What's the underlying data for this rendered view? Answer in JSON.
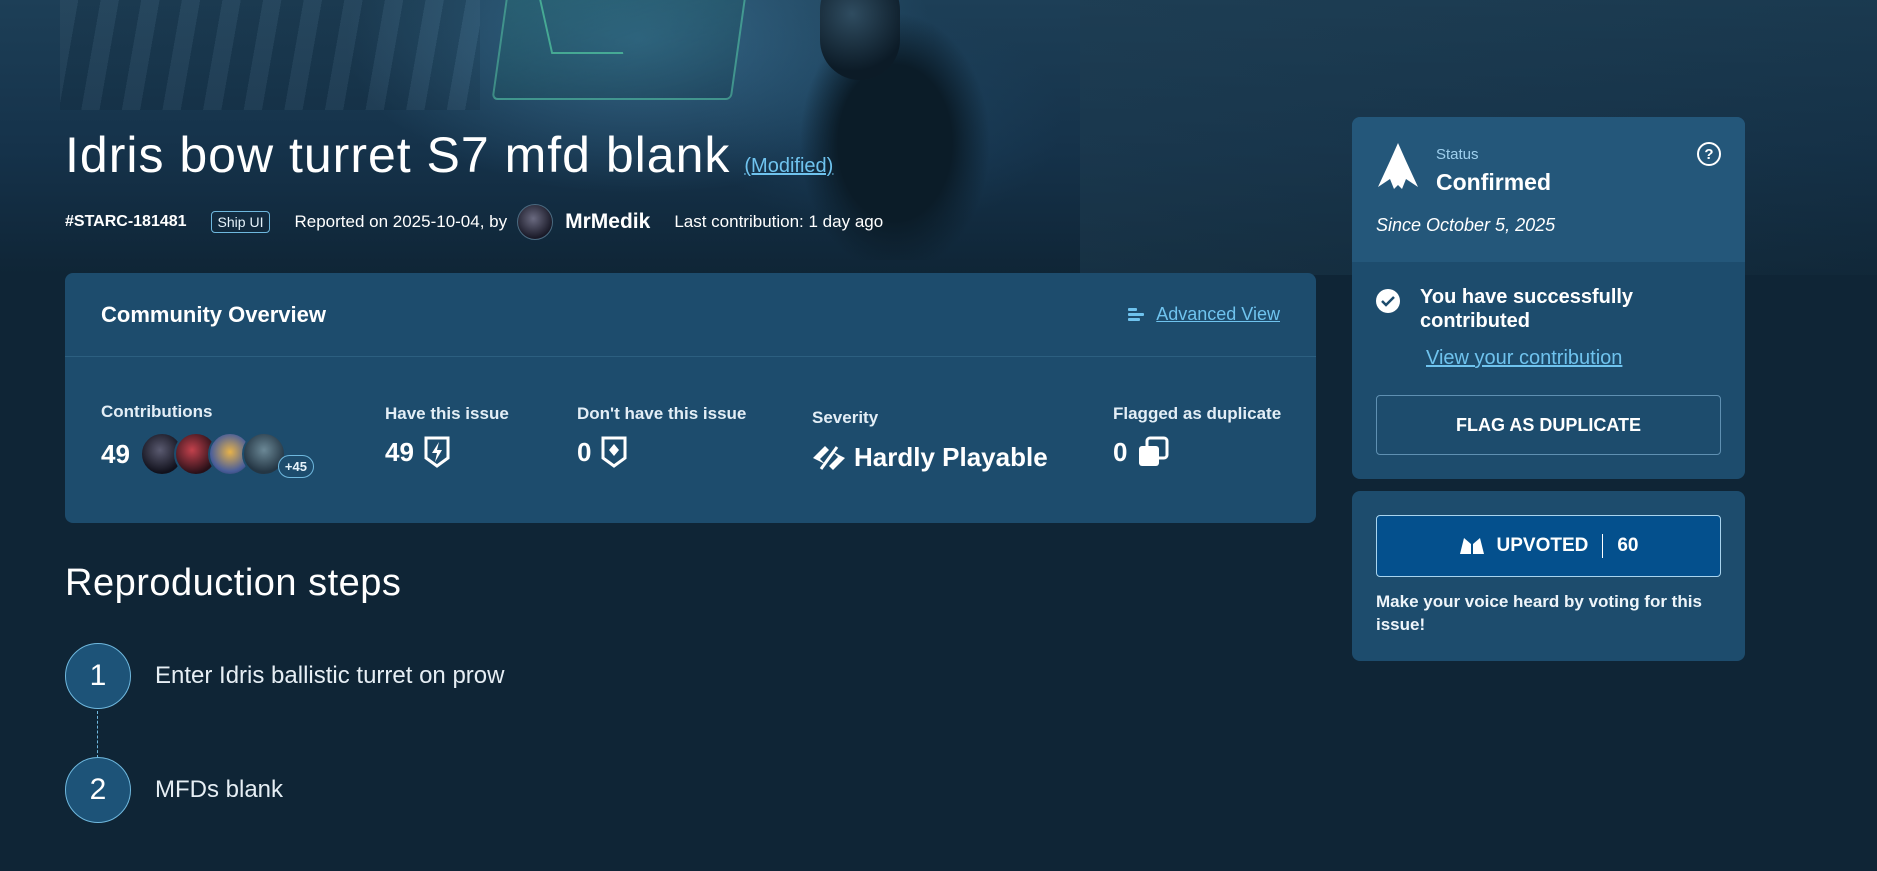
{
  "issue": {
    "title": "Idris bow turret S7 mfd blank",
    "modified_label": "(Modified)",
    "id": "#STARC-181481",
    "tag": "Ship UI",
    "reported_text": "Reported on 2025-10-04, by",
    "reporter": "MrMedik",
    "last_contribution": "Last contribution: 1 day ago"
  },
  "overview": {
    "title": "Community Overview",
    "advanced_view": "Advanced View",
    "contributions_label": "Contributions",
    "contributions_value": "49",
    "contributors_more": "+45",
    "have_label": "Have this issue",
    "have_value": "49",
    "dont_have_label": "Don't have this issue",
    "dont_have_value": "0",
    "severity_label": "Severity",
    "severity_value": "Hardly Playable",
    "duplicate_label": "Flagged as duplicate",
    "duplicate_value": "0"
  },
  "repro": {
    "title": "Reproduction steps",
    "steps": [
      {
        "number": "1",
        "text": "Enter Idris ballistic turret on prow"
      },
      {
        "number": "2",
        "text": "MFDs blank"
      }
    ]
  },
  "status": {
    "label": "Status",
    "value": "Confirmed",
    "since": "Since October 5, 2025",
    "help": "?",
    "contributed_text": "You have successfully contributed",
    "view_contribution": "View your contribution",
    "flag_button": "FLAG AS DUPLICATE"
  },
  "vote": {
    "button_label": "UPVOTED",
    "count": "60",
    "message": "Make your voice heard by voting for this issue!"
  },
  "colors": {
    "background": "#0f2536",
    "panel": "#1d4c6d",
    "accent_link": "#6fc3ee",
    "upvote_button": "#04508d"
  }
}
